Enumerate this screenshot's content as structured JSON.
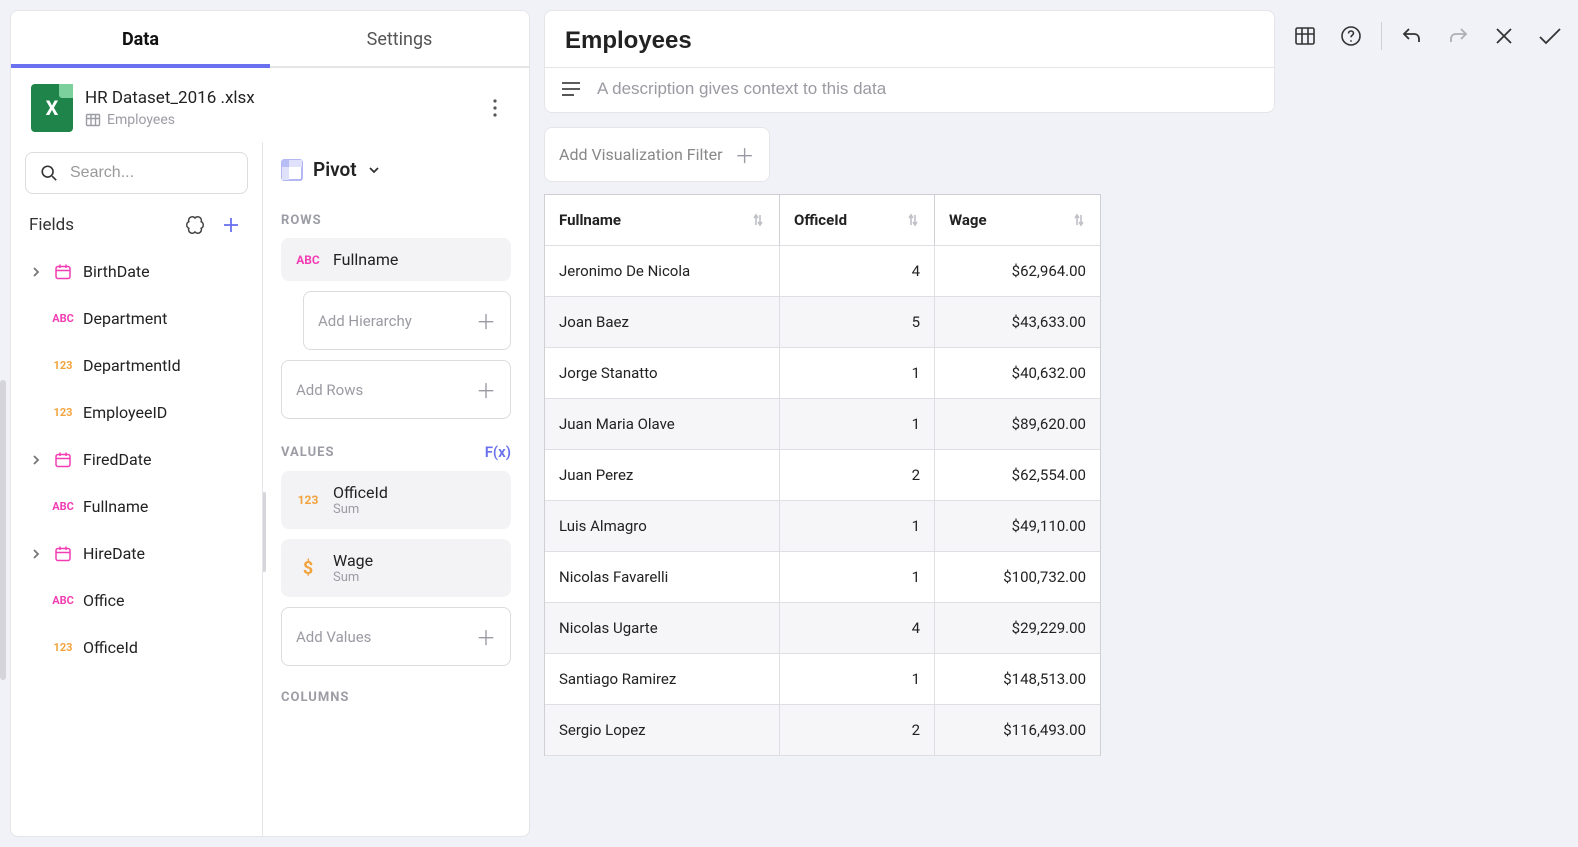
{
  "tabs": {
    "data": "Data",
    "settings": "Settings"
  },
  "dataset": {
    "filename": "HR Dataset_2016 .xlsx",
    "table": "Employees"
  },
  "search": {
    "placeholder": "Search..."
  },
  "fieldsPanel": {
    "title": "Fields"
  },
  "fields": [
    {
      "name": "BirthDate",
      "type": "date",
      "expandable": true
    },
    {
      "name": "Department",
      "type": "abc",
      "expandable": false
    },
    {
      "name": "DepartmentId",
      "type": "123",
      "expandable": false
    },
    {
      "name": "EmployeeID",
      "type": "123",
      "expandable": false
    },
    {
      "name": "FiredDate",
      "type": "date",
      "expandable": true
    },
    {
      "name": "Fullname",
      "type": "abc",
      "expandable": false
    },
    {
      "name": "HireDate",
      "type": "date",
      "expandable": true
    },
    {
      "name": "Office",
      "type": "abc",
      "expandable": false
    },
    {
      "name": "OfficeId",
      "type": "123",
      "expandable": false
    }
  ],
  "pivot": {
    "label": "Pivot",
    "sections": {
      "rows": "ROWS",
      "values": "VALUES",
      "columns": "COLUMNS"
    },
    "fx": "F(x)",
    "drop": {
      "hierarchy": "Add Hierarchy",
      "rows": "Add Rows",
      "values": "Add Values"
    },
    "rowsChips": [
      {
        "name": "Fullname",
        "type": "abc"
      }
    ],
    "valueChips": [
      {
        "name": "OfficeId",
        "agg": "Sum",
        "type": "123"
      },
      {
        "name": "Wage",
        "agg": "Sum",
        "type": "money"
      }
    ]
  },
  "viz": {
    "title": "Employees",
    "descPlaceholder": "A description gives context to this data",
    "filterLabel": "Add Visualization Filter"
  },
  "grid": {
    "columns": [
      {
        "key": "fullname",
        "label": "Fullname",
        "align": "left"
      },
      {
        "key": "officeId",
        "label": "OfficeId",
        "align": "right"
      },
      {
        "key": "wage",
        "label": "Wage",
        "align": "right"
      }
    ],
    "rows": [
      {
        "fullname": "Jeronimo De Nicola",
        "officeId": "4",
        "wage": "$62,964.00"
      },
      {
        "fullname": "Joan Baez",
        "officeId": "5",
        "wage": "$43,633.00"
      },
      {
        "fullname": "Jorge Stanatto",
        "officeId": "1",
        "wage": "$40,632.00"
      },
      {
        "fullname": "Juan Maria Olave",
        "officeId": "1",
        "wage": "$89,620.00"
      },
      {
        "fullname": "Juan Perez",
        "officeId": "2",
        "wage": "$62,554.00"
      },
      {
        "fullname": "Luis Almagro",
        "officeId": "1",
        "wage": "$49,110.00"
      },
      {
        "fullname": "Nicolas Favarelli",
        "officeId": "1",
        "wage": "$100,732.00"
      },
      {
        "fullname": "Nicolas Ugarte",
        "officeId": "4",
        "wage": "$29,229.00"
      },
      {
        "fullname": "Santiago Ramirez",
        "officeId": "1",
        "wage": "$148,513.00"
      },
      {
        "fullname": "Sergio Lopez",
        "officeId": "2",
        "wage": "$116,493.00"
      }
    ]
  },
  "chart_data": {
    "type": "table",
    "title": "Employees",
    "columns": [
      "Fullname",
      "OfficeId",
      "Wage"
    ],
    "rows": [
      [
        "Jeronimo De Nicola",
        4,
        62964.0
      ],
      [
        "Joan Baez",
        5,
        43633.0
      ],
      [
        "Jorge Stanatto",
        1,
        40632.0
      ],
      [
        "Juan Maria Olave",
        1,
        89620.0
      ],
      [
        "Juan Perez",
        2,
        62554.0
      ],
      [
        "Luis Almagro",
        1,
        49110.0
      ],
      [
        "Nicolas Favarelli",
        1,
        100732.0
      ],
      [
        "Nicolas Ugarte",
        4,
        29229.0
      ],
      [
        "Santiago Ramirez",
        1,
        148513.0
      ],
      [
        "Sergio Lopez",
        2,
        116493.0
      ]
    ]
  }
}
